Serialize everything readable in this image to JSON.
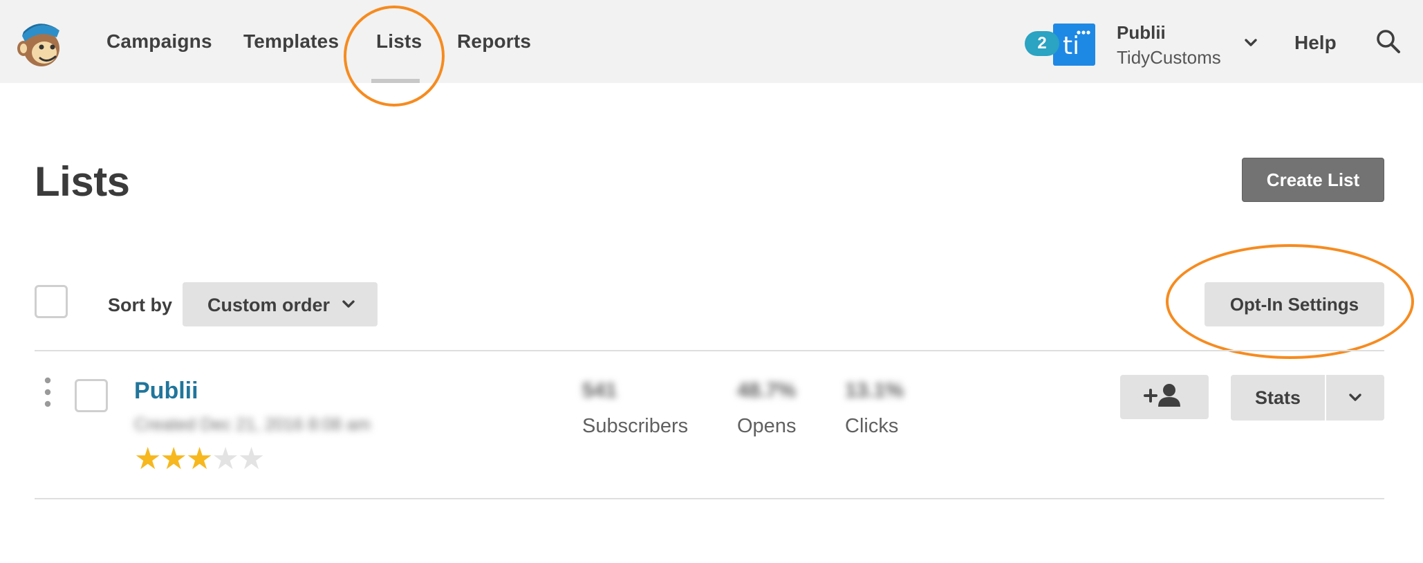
{
  "header": {
    "nav": [
      {
        "label": "Campaigns"
      },
      {
        "label": "Templates"
      },
      {
        "label": "Lists",
        "active": true
      },
      {
        "label": "Reports"
      }
    ],
    "notification_count": "2",
    "app_tile_text": "ti",
    "account": {
      "name": "Publii",
      "subtitle": "TidyCustoms"
    },
    "help_label": "Help",
    "icons": {
      "logo": "mailchimp-monkey-logo",
      "search": "search-icon",
      "account_menu": "chevron-down-icon"
    }
  },
  "page": {
    "title": "Lists",
    "create_button": "Create List"
  },
  "toolbar": {
    "sort_label": "Sort by",
    "sort_value": "Custom order",
    "optin_button": "Opt-In Settings"
  },
  "lists": [
    {
      "name": "Publii",
      "created": "Created Dec 21, 2016 8:08 am",
      "rating": 3,
      "rating_max": 5,
      "stats": [
        {
          "value": "541",
          "label": "Subscribers"
        },
        {
          "value": "48.7%",
          "label": "Opens"
        },
        {
          "value": "13.1%",
          "label": "Clicks"
        }
      ],
      "stats_button": "Stats"
    }
  ],
  "colors": {
    "accent_highlight": "#f68b1f",
    "link": "#21759b",
    "badge": "#2ba3c2",
    "star": "#f6b81e",
    "app_tile": "#1e88e5"
  }
}
